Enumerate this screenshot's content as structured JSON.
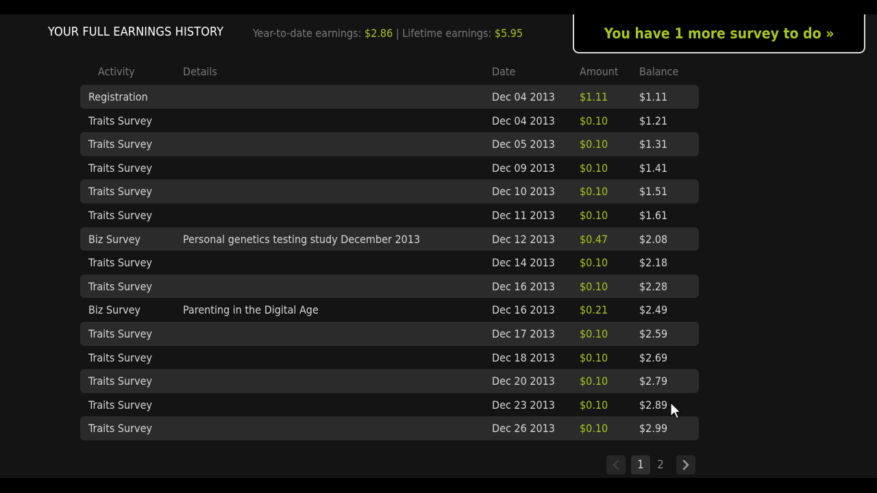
{
  "header": {
    "title": "YOUR FULL EARNINGS HISTORY",
    "ytd_label": "Year-to-date earnings:",
    "ytd_value": "$2.86",
    "separator": "|",
    "lifetime_label": "Lifetime earnings:",
    "lifetime_value": "$5.95",
    "cta_label": "You have 1 more survey to do »"
  },
  "table": {
    "columns": [
      "Activity",
      "Details",
      "Date",
      "Amount",
      "Balance"
    ],
    "rows": [
      {
        "activity": "Registration",
        "details": "",
        "date": "Dec 04 2013",
        "amount": "$1.11",
        "balance": "$1.11"
      },
      {
        "activity": "Traits Survey",
        "details": "",
        "date": "Dec 04 2013",
        "amount": "$0.10",
        "balance": "$1.21"
      },
      {
        "activity": "Traits Survey",
        "details": "",
        "date": "Dec 05 2013",
        "amount": "$0.10",
        "balance": "$1.31"
      },
      {
        "activity": "Traits Survey",
        "details": "",
        "date": "Dec 09 2013",
        "amount": "$0.10",
        "balance": "$1.41"
      },
      {
        "activity": "Traits Survey",
        "details": "",
        "date": "Dec 10 2013",
        "amount": "$0.10",
        "balance": "$1.51"
      },
      {
        "activity": "Traits Survey",
        "details": "",
        "date": "Dec 11 2013",
        "amount": "$0.10",
        "balance": "$1.61"
      },
      {
        "activity": "Biz Survey",
        "details": "Personal genetics testing study December 2013",
        "date": "Dec 12 2013",
        "amount": "$0.47",
        "balance": "$2.08"
      },
      {
        "activity": "Traits Survey",
        "details": "",
        "date": "Dec 14 2013",
        "amount": "$0.10",
        "balance": "$2.18"
      },
      {
        "activity": "Traits Survey",
        "details": "",
        "date": "Dec 16 2013",
        "amount": "$0.10",
        "balance": "$2.28"
      },
      {
        "activity": "Biz Survey",
        "details": "Parenting in the Digital Age",
        "date": "Dec 16 2013",
        "amount": "$0.21",
        "balance": "$2.49"
      },
      {
        "activity": "Traits Survey",
        "details": "",
        "date": "Dec 17 2013",
        "amount": "$0.10",
        "balance": "$2.59"
      },
      {
        "activity": "Traits Survey",
        "details": "",
        "date": "Dec 18 2013",
        "amount": "$0.10",
        "balance": "$2.69"
      },
      {
        "activity": "Traits Survey",
        "details": "",
        "date": "Dec 20 2013",
        "amount": "$0.10",
        "balance": "$2.79"
      },
      {
        "activity": "Traits Survey",
        "details": "",
        "date": "Dec 23 2013",
        "amount": "$0.10",
        "balance": "$2.89"
      },
      {
        "activity": "Traits Survey",
        "details": "",
        "date": "Dec 26 2013",
        "amount": "$0.10",
        "balance": "$2.99"
      }
    ]
  },
  "pagination": {
    "pages": [
      "1",
      "2"
    ],
    "current": "1",
    "prev_icon": "chevron-left-icon",
    "next_icon": "chevron-right-icon"
  },
  "colors": {
    "accent": "#a6c71f",
    "background": "#141414",
    "row_stripe": "#2b2b2b"
  }
}
